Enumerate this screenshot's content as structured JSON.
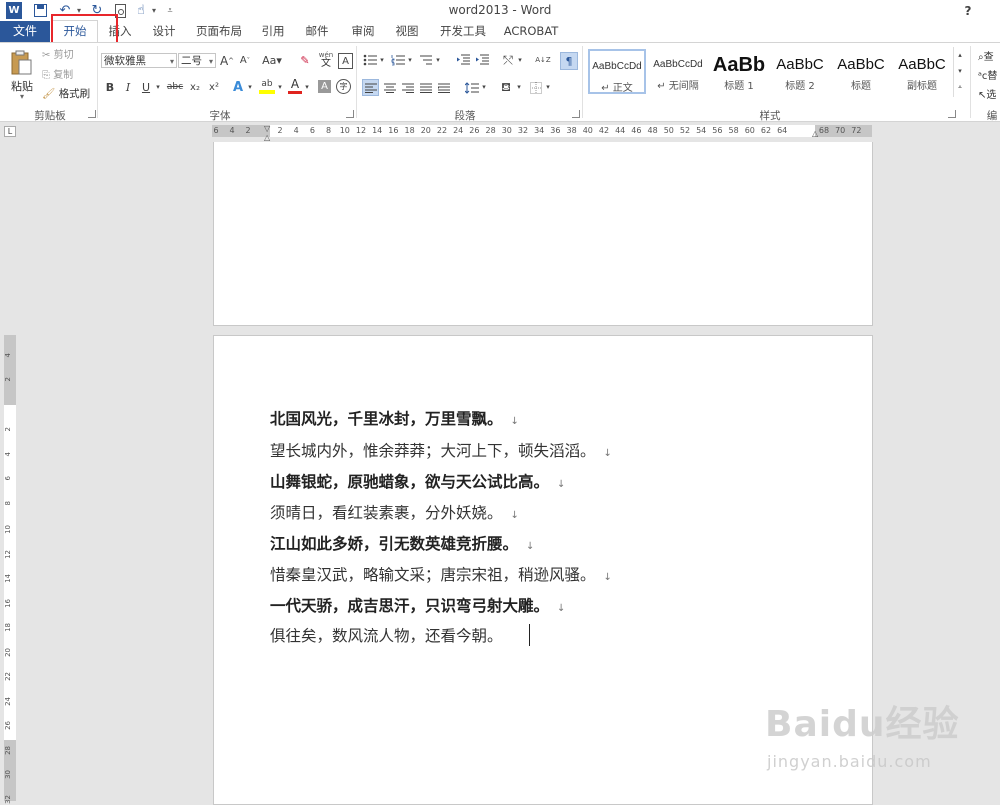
{
  "window": {
    "title": "word2013 - Word",
    "help": "?"
  },
  "tabs": {
    "file": "文件",
    "items": [
      "开始",
      "插入",
      "设计",
      "页面布局",
      "引用",
      "邮件",
      "审阅",
      "视图",
      "开发工具",
      "ACROBAT"
    ]
  },
  "clipboard": {
    "paste": "粘贴",
    "cut": "剪切",
    "copy": "复制",
    "format_painter": "格式刷",
    "group": "剪贴板"
  },
  "font": {
    "name": "微软雅黑",
    "size": "二号",
    "group": "字体",
    "aa": "Aa",
    "grow": "A",
    "shrink": "A",
    "wen": "wén",
    "wen_char": "文",
    "box_a": "A",
    "bold": "B",
    "italic": "I",
    "underline": "U",
    "strike": "abc",
    "subscript": "x₂",
    "superscript": "x²",
    "effects": "A",
    "highlight": "ab",
    "color": "A",
    "shade": "A",
    "circle": "字"
  },
  "paragraph": {
    "group": "段落",
    "sort": "A↓Z"
  },
  "styles": {
    "group": "样式",
    "items": [
      {
        "preview": "AaBbCcDd",
        "name": "↵ 正文"
      },
      {
        "preview": "AaBbCcDd",
        "name": "↵ 无间隔"
      },
      {
        "preview": "AaBb",
        "name": "标题 1"
      },
      {
        "preview": "AaBbC",
        "name": "标题 2"
      },
      {
        "preview": "AaBbC",
        "name": "标题"
      },
      {
        "preview": "AaBbC",
        "name": "副标题"
      }
    ]
  },
  "editing": {
    "find": "查",
    "replace": "替",
    "select": "选",
    "group": "编"
  },
  "ruler": {
    "h_ticks": [
      "6",
      "4",
      "2",
      "2",
      "4",
      "6",
      "8",
      "10",
      "12",
      "14",
      "16",
      "18",
      "20",
      "22",
      "24",
      "26",
      "28",
      "30",
      "32",
      "34",
      "36",
      "38",
      "40",
      "42",
      "44",
      "46",
      "48",
      "50",
      "52",
      "54",
      "56",
      "58",
      "60",
      "62",
      "64",
      "68",
      "70",
      "72"
    ],
    "v_ticks": [
      "4",
      "2",
      "2",
      "4",
      "6",
      "8",
      "10",
      "12",
      "14",
      "16",
      "18",
      "20",
      "22",
      "24",
      "26",
      "28",
      "30",
      "32"
    ],
    "corner": "L"
  },
  "document": {
    "lines": [
      {
        "text": "北国风光，千里冰封，万里雪飘。",
        "bold": true
      },
      {
        "text": "望长城内外，惟余莽莽；大河上下，顿失滔滔。",
        "bold": false
      },
      {
        "text": "山舞银蛇，原驰蜡象，欲与天公试比高。",
        "bold": true
      },
      {
        "text": "须晴日，看红装素裹，分外妖娆。",
        "bold": false
      },
      {
        "text": "江山如此多娇，引无数英雄竞折腰。",
        "bold": true
      },
      {
        "text": "惜秦皇汉武，略输文采；唐宗宋祖，稍逊风骚。",
        "bold": false
      },
      {
        "text": "一代天骄，成吉思汗，只识弯弓射大雕。",
        "bold": true
      },
      {
        "text": "俱往矣，数风流人物，还看今朝。",
        "bold": false
      }
    ],
    "para_mark": "↓"
  },
  "watermark": {
    "brand": "Baidu经验",
    "url": "jingyan.baidu.com"
  }
}
